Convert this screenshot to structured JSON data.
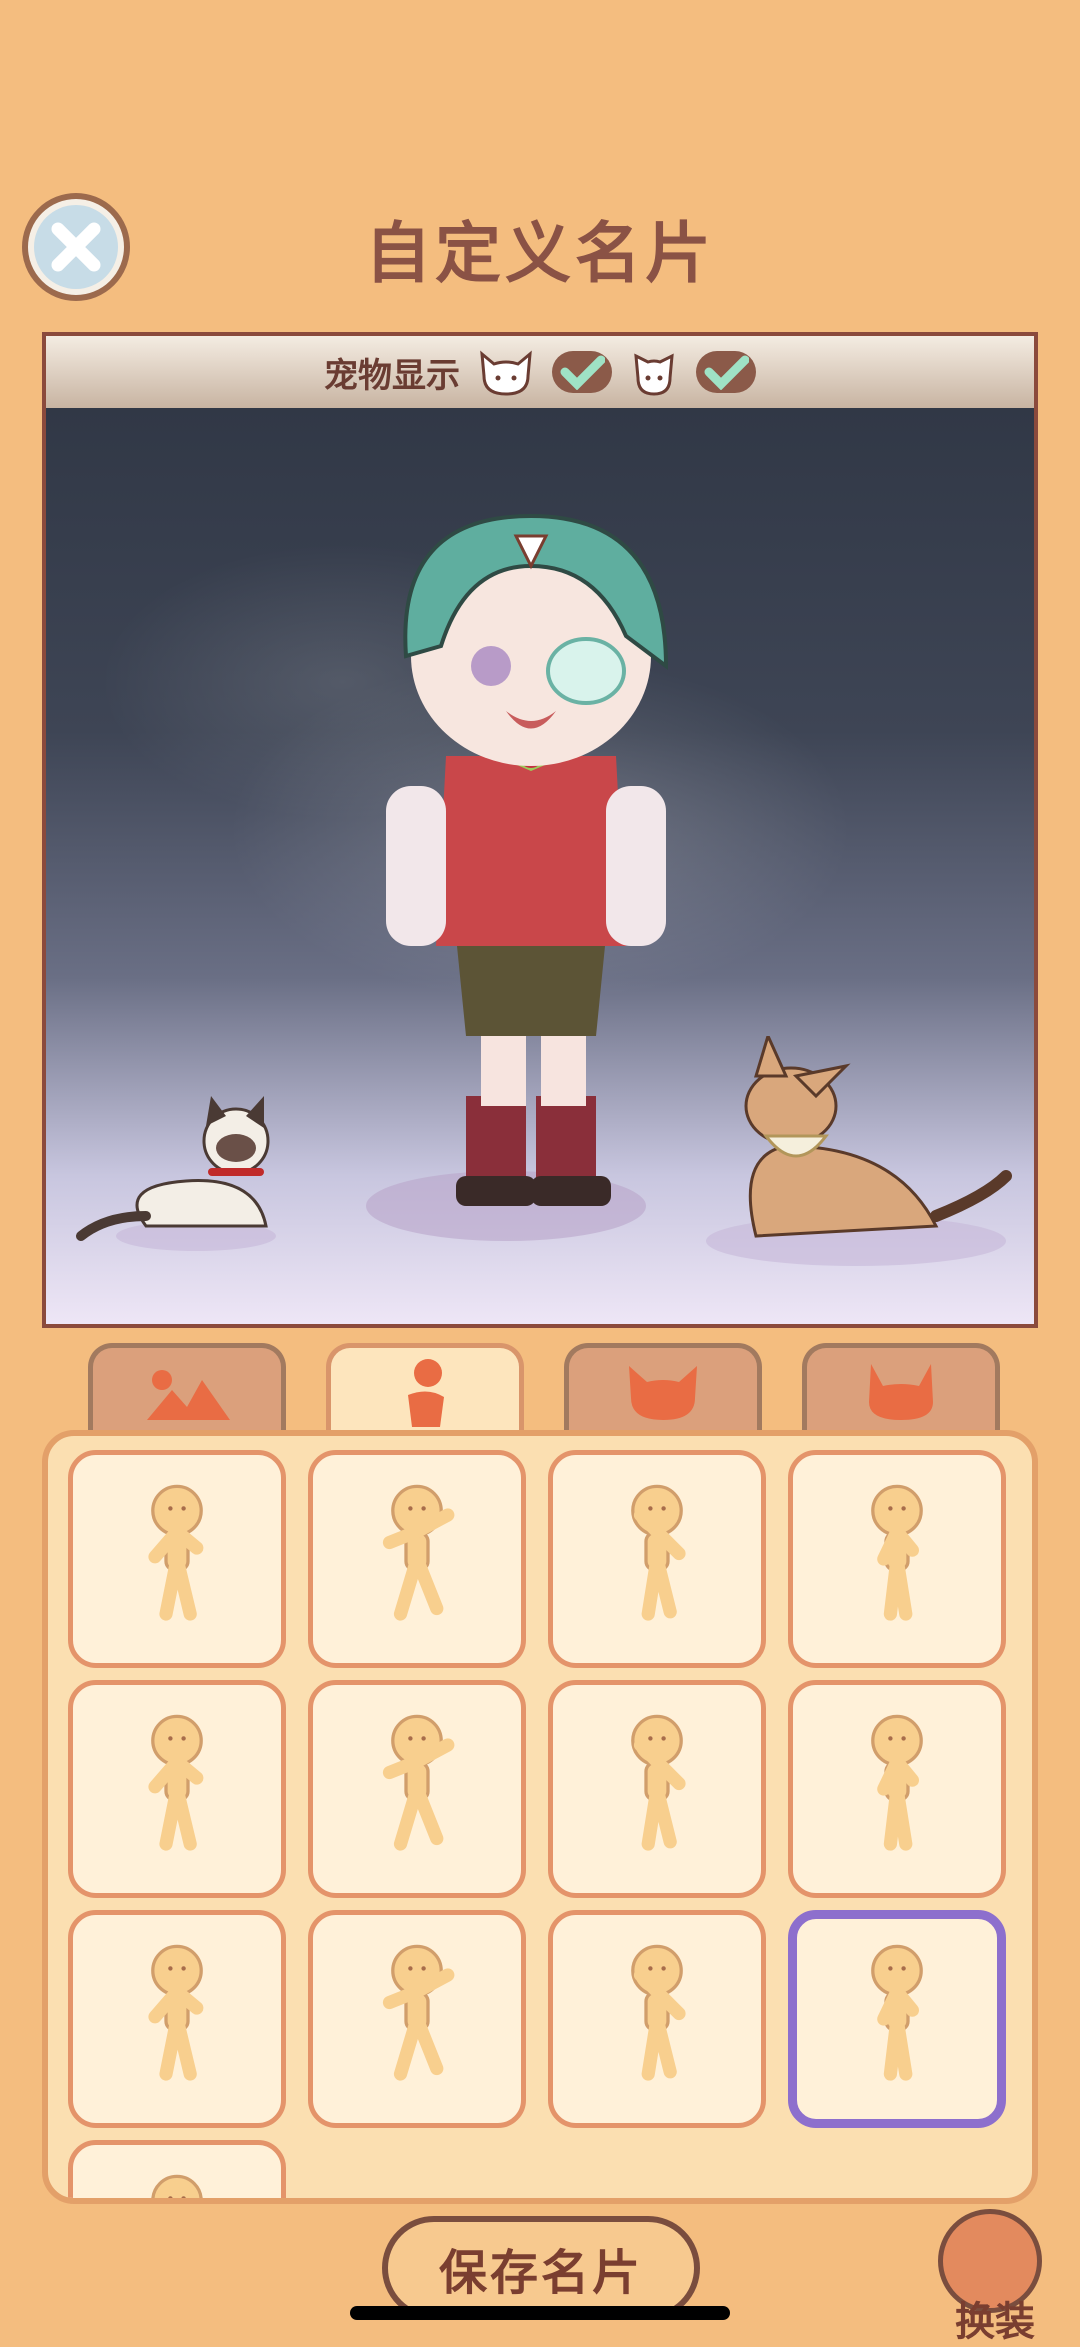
{
  "title": "自定义名片",
  "pet_display": {
    "label": "宠物显示",
    "cat_checked": true,
    "dog_checked": true
  },
  "tabs": [
    {
      "icon": "background-icon",
      "active": false
    },
    {
      "icon": "pose-icon",
      "active": true
    },
    {
      "icon": "cat-icon",
      "active": false
    },
    {
      "icon": "cat-icon",
      "active": false
    }
  ],
  "poses": {
    "count_visible": 13,
    "selected_index": 11
  },
  "save_button": "保存名片",
  "dress_button": "换装",
  "colors": {
    "background": "#f4bd7f",
    "title": "#8a5245",
    "selection": "#8d6fcd"
  }
}
